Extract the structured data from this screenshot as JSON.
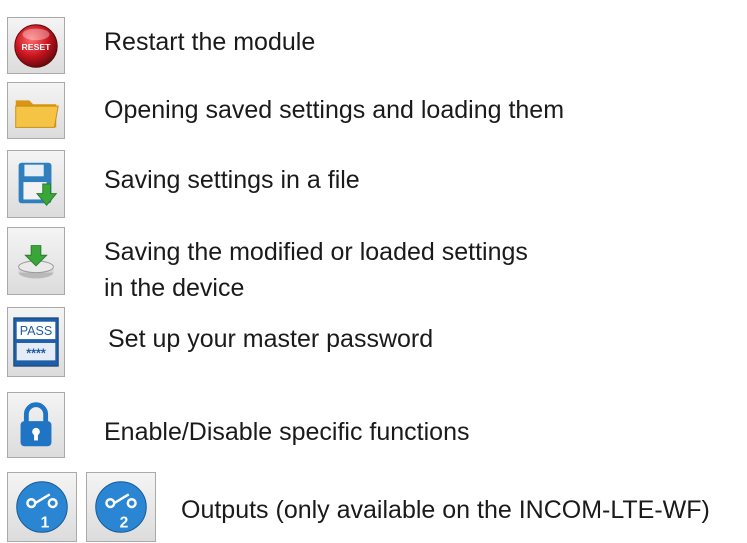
{
  "legend": {
    "items": [
      {
        "icon": "reset-icon",
        "icon_text": "RESET",
        "description": "Restart the module"
      },
      {
        "icon": "folder-open-icon",
        "description": "Opening saved settings and loading them"
      },
      {
        "icon": "save-file-icon",
        "description": "Saving settings in a file"
      },
      {
        "icon": "save-to-device-icon",
        "description_line1": "Saving the modified or loaded settings",
        "description_line2": "in the device"
      },
      {
        "icon": "password-icon",
        "icon_text_top": "PASS",
        "icon_text_bottom": "****",
        "description": "Set up your master password"
      },
      {
        "icon": "lock-icon",
        "description": "Enable/Disable specific functions"
      },
      {
        "icons": [
          "output-1-icon",
          "output-2-icon"
        ],
        "icon_numbers": [
          "1",
          "2"
        ],
        "description": "Outputs (only available on the INCOM-LTE-WF)"
      }
    ]
  },
  "colors": {
    "button_border": "#a9a9a9",
    "button_bg": "#e6e6e6",
    "reset_red": "#c8141e",
    "folder_yellow": "#f2b01f",
    "disk_blue": "#2f7fbf",
    "arrow_green": "#3aa63a",
    "pass_blue": "#1f5ea8",
    "lock_blue": "#1f74c4",
    "output_blue": "#2a86d2"
  }
}
